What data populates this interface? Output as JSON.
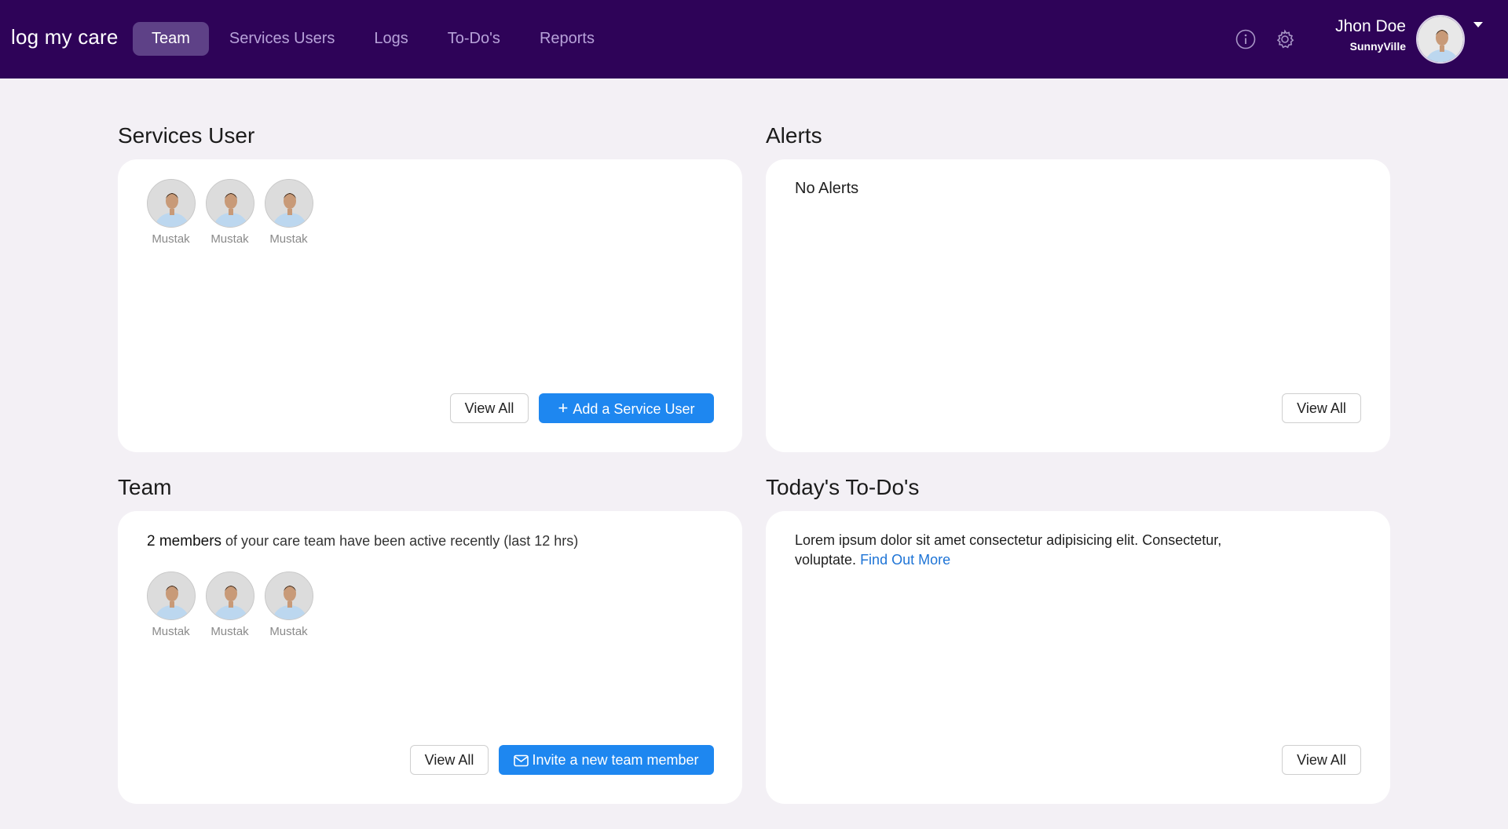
{
  "app": {
    "brand": "log my care"
  },
  "nav": {
    "items": [
      {
        "label": "Team",
        "active": true
      },
      {
        "label": "Services Users",
        "active": false
      },
      {
        "label": "Logs",
        "active": false
      },
      {
        "label": "To-Do's",
        "active": false
      },
      {
        "label": "Reports",
        "active": false
      }
    ]
  },
  "header_icons": {
    "info": "info-icon",
    "settings": "gear-icon",
    "dropdown": "chevron-down-icon"
  },
  "user": {
    "name": "Jhon Doe",
    "org": "SunnyVille"
  },
  "services_user": {
    "title": "Services User",
    "members": [
      {
        "name": "Mustak"
      },
      {
        "name": "Mustak"
      },
      {
        "name": "Mustak"
      }
    ],
    "view_all_label": "View All",
    "add_button_label": "Add a Service User",
    "add_icon": "plus-icon"
  },
  "alerts": {
    "title": "Alerts",
    "empty_text": "No Alerts",
    "view_all_label": "View All"
  },
  "team": {
    "title": "Team",
    "status_count": "2 members",
    "status_rest": " of your care team have been active recently (last 12 hrs)",
    "members": [
      {
        "name": "Mustak"
      },
      {
        "name": "Mustak"
      },
      {
        "name": "Mustak"
      }
    ],
    "view_all_label": "View All",
    "invite_button_label": "Invite a new team member",
    "invite_icon": "envelope-icon"
  },
  "todos": {
    "title": "Today's To-Do's",
    "text": "Lorem ipsum dolor sit amet consectetur adipisicing elit. Consectetur, voluptate. ",
    "link_label": "Find Out More",
    "view_all_label": "View All"
  },
  "colors": {
    "topbar": "#2e0358",
    "active_tab": "#5e4187",
    "primary": "#1e87f0",
    "link": "#1e74d6",
    "background": "#f3f0f5"
  }
}
